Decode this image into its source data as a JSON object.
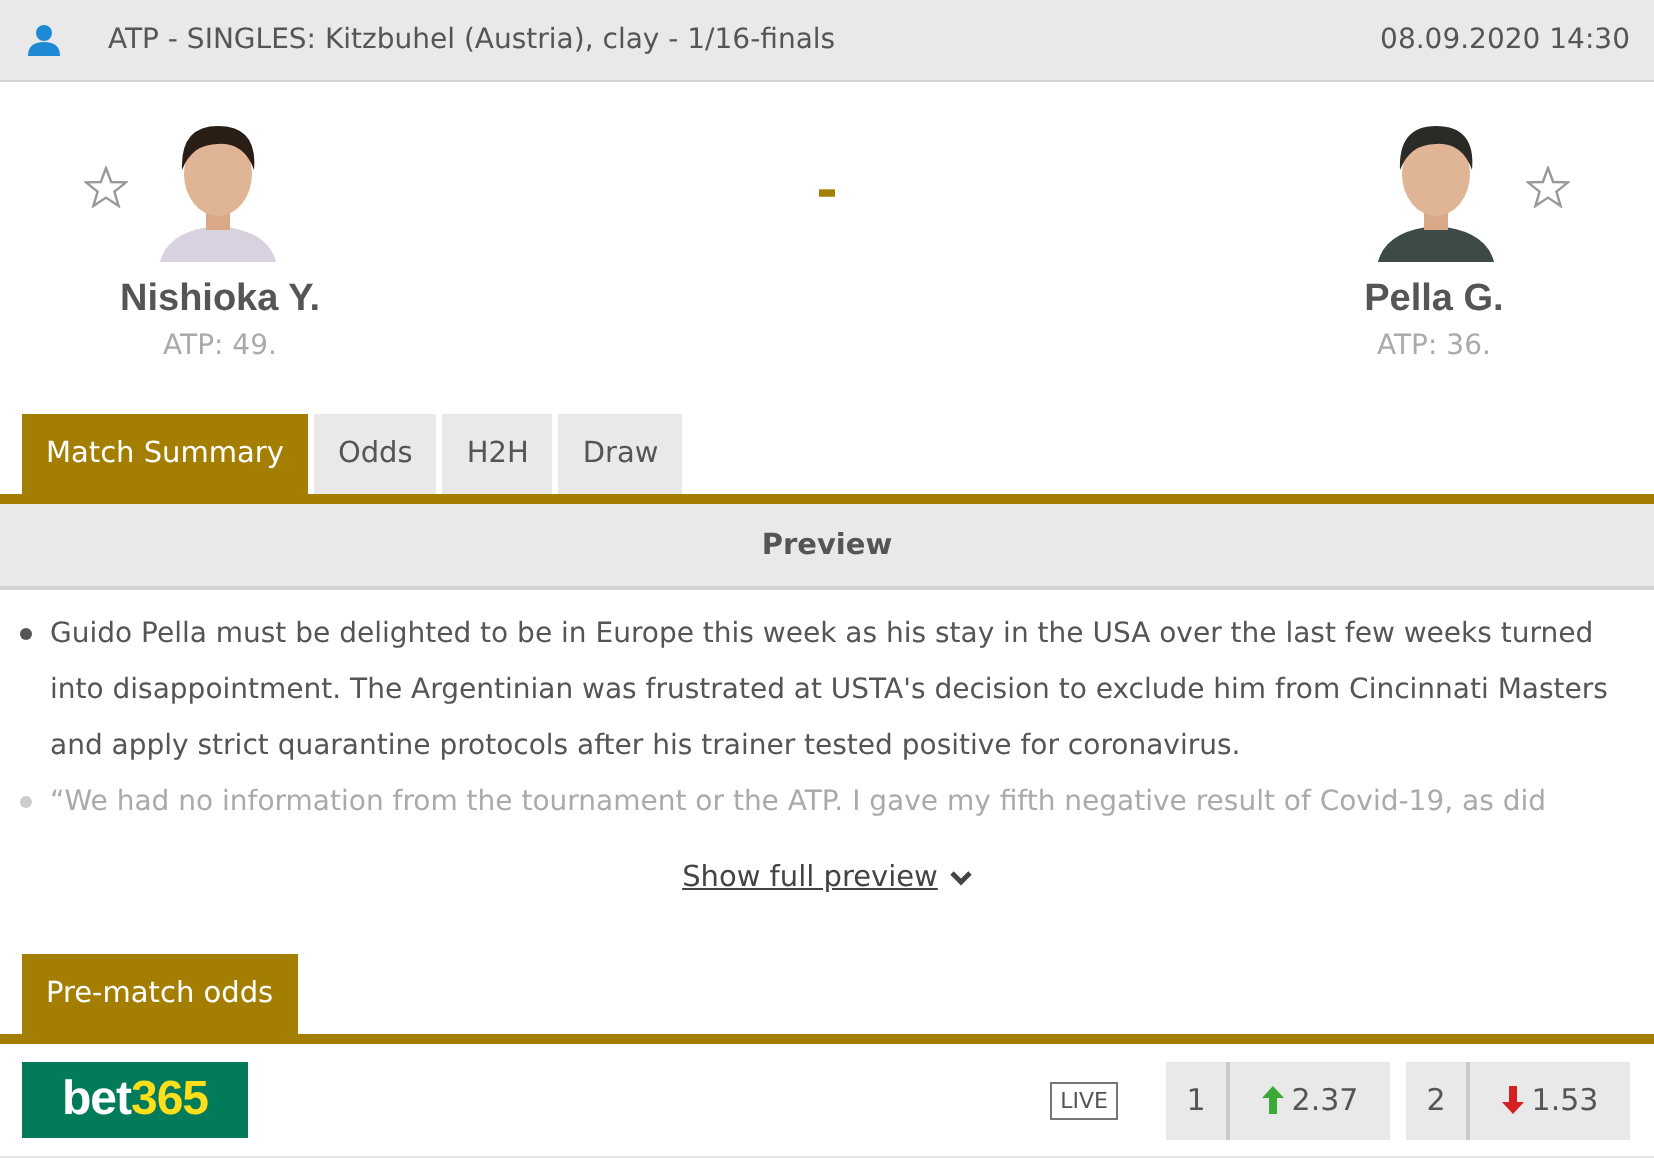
{
  "header": {
    "title": "ATP - SINGLES: Kitzbuhel (Austria), clay - 1/16-finals",
    "datetime": "08.09.2020 14:30"
  },
  "players": [
    {
      "name": "Nishioka Y.",
      "rank": "ATP: 49.",
      "favorite": false
    },
    {
      "name": "Pella G.",
      "rank": "ATP: 36.",
      "favorite": false
    }
  ],
  "score": "-",
  "tabs": [
    {
      "label": "Match Summary",
      "selected": true
    },
    {
      "label": "Odds",
      "selected": false
    },
    {
      "label": "H2H",
      "selected": false
    },
    {
      "label": "Draw",
      "selected": false
    }
  ],
  "preview": {
    "title": "Preview",
    "items": [
      "Guido Pella must be delighted to be in Europe this week as his stay in the USA over the last few weeks turned into disappointment. The Argentinian was frustrated at USTA's decision to exclude him from Cincinnati Masters and apply strict quarantine protocols after his trainer tested positive for coronavirus.",
      "“We had no information from the tournament or the ATP. I gave my fifth negative result of Covid-19, as did"
    ],
    "more": "Show full preview"
  },
  "odds_tab": {
    "label": "Pre-match odds",
    "selected": true
  },
  "bookmaker": {
    "logo_a": "bet",
    "logo_b": "365",
    "live": "LIVE",
    "odds": [
      {
        "label": "1",
        "value": "2.37",
        "kind": "up"
      },
      {
        "label": "2",
        "value": "1.53",
        "kind": "down"
      }
    ]
  }
}
